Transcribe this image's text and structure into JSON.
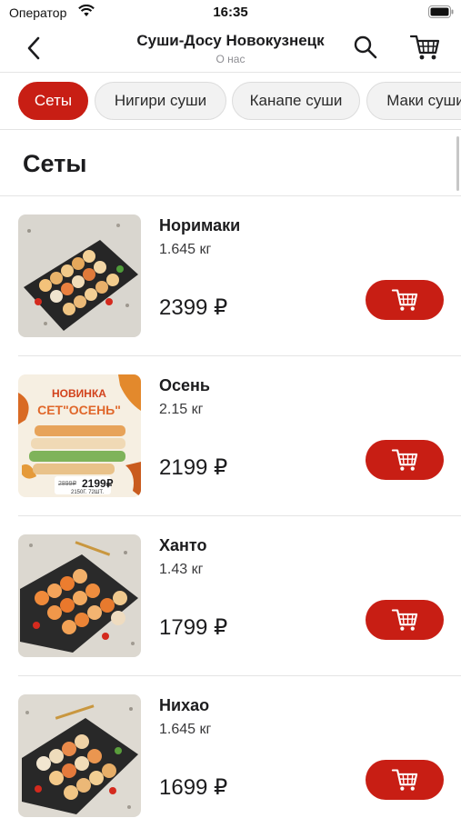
{
  "status_bar": {
    "carrier": "Оператор",
    "time": "16:35"
  },
  "nav": {
    "title": "Суши-Досу Новокузнецк",
    "subtitle": "О нас"
  },
  "categories": [
    {
      "label": "Сеты",
      "active": true
    },
    {
      "label": "Нигири суши",
      "active": false
    },
    {
      "label": "Канапе суши",
      "active": false
    },
    {
      "label": "Маки суши",
      "active": false
    }
  ],
  "section": {
    "title": "Сеты"
  },
  "products": [
    {
      "name": "Норимаки",
      "weight": "1.645 кг",
      "price": "2399 ₽"
    },
    {
      "name": "Осень",
      "weight": "2.15 кг",
      "price": "2199 ₽"
    },
    {
      "name": "Ханто",
      "weight": "1.43 кг",
      "price": "1799 ₽"
    },
    {
      "name": "Нихао",
      "weight": "1.645 кг",
      "price": "1699 ₽"
    }
  ],
  "promo": {
    "badge": "НОВИНКА",
    "title": "СЕТ\"ОСЕНЬ\"",
    "old_price": "2899₽",
    "new_price": "2199₽",
    "details": "2150Г. 72ШТ."
  },
  "colors": {
    "accent": "#c81e14",
    "divider": "#e4e4e4",
    "chip_bg": "#f2f2f2"
  },
  "icons": {
    "back": "chevron-left-icon",
    "search": "magnifier-icon",
    "cart": "shopping-cart-icon"
  }
}
